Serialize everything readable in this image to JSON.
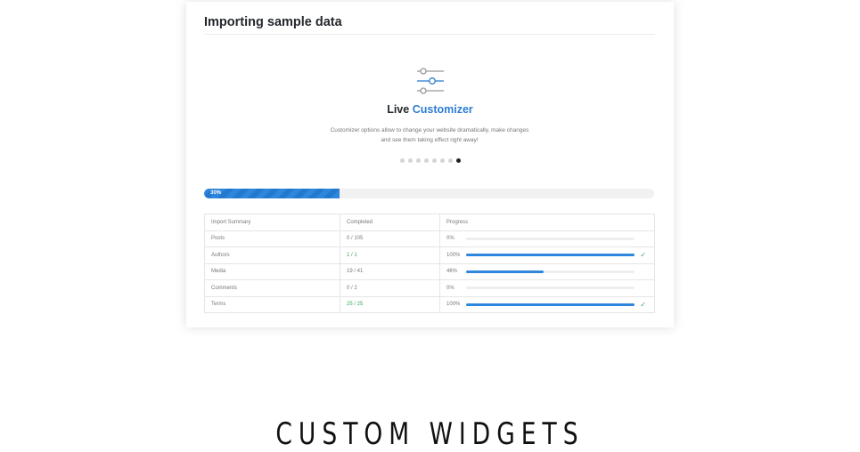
{
  "card": {
    "title": "Importing sample data"
  },
  "slide": {
    "icon": "sliders-icon",
    "heading_prefix": "Live",
    "heading_accent": "Customizer",
    "description": "Customizer options allow to change your website dramatically, make changes and see them taking effect right away!",
    "dot_count": 8,
    "active_dot": 7
  },
  "overall_progress": {
    "label": "30%",
    "value": 0.3
  },
  "summary": {
    "headers": [
      "Import Summary",
      "Completed",
      "Progress"
    ],
    "rows": [
      {
        "name": "Posts",
        "completed": "0 / 105",
        "percent_label": "0%",
        "value": 0.0,
        "done": false
      },
      {
        "name": "Authors",
        "completed": "1 / 1",
        "percent_label": "100%",
        "value": 1.0,
        "done": true
      },
      {
        "name": "Media",
        "completed": "19 / 41",
        "percent_label": "46%",
        "value": 0.46,
        "done": false
      },
      {
        "name": "Comments",
        "completed": "0 / 2",
        "percent_label": "0%",
        "value": 0.0,
        "done": false
      },
      {
        "name": "Terms",
        "completed": "25 / 25",
        "percent_label": "100%",
        "value": 1.0,
        "done": true
      }
    ]
  },
  "footer": {
    "heading": "CUSTOM WIDGETS"
  },
  "colors": {
    "accent": "#2d7dd2",
    "success": "#3ba55c",
    "track": "#f1f1f1"
  }
}
